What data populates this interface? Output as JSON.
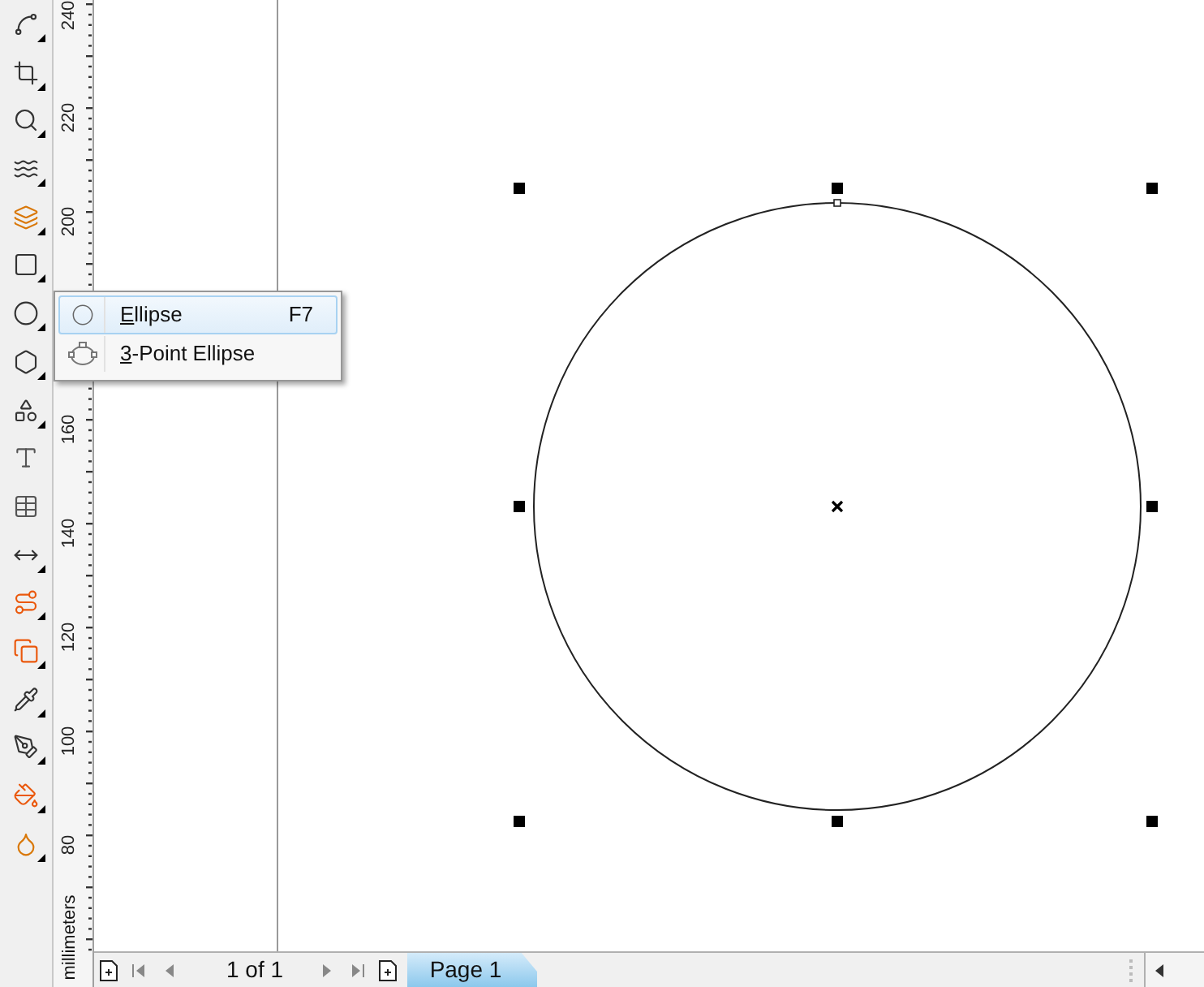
{
  "toolbox": {
    "tools": [
      {
        "flyout": true
      },
      {
        "flyout": true
      },
      {
        "flyout": true
      },
      {
        "flyout": true
      },
      {
        "flyout": true
      },
      {
        "flyout": true
      },
      {
        "flyout": true
      },
      {
        "flyout": true
      },
      {
        "flyout": true
      },
      {
        "flyout": false
      },
      {
        "flyout": false
      },
      {
        "flyout": true
      },
      {
        "flyout": true
      },
      {
        "flyout": true
      },
      {
        "flyout": true
      },
      {
        "flyout": true
      },
      {
        "flyout": true
      },
      {
        "flyout": true
      }
    ]
  },
  "ruler": {
    "labels": [
      "240",
      "220",
      "200",
      "160",
      "140",
      "120",
      "100",
      "80"
    ],
    "unit": "millimeters"
  },
  "flyout_menu": {
    "items": [
      {
        "mnemonic": "E",
        "rest": "llipse",
        "shortcut": "F7",
        "selected": true
      },
      {
        "mnemonic": "3",
        "rest": "-Point Ellipse",
        "selected": false
      }
    ]
  },
  "page_nav": {
    "counter": "1 of 1",
    "tabs": [
      {
        "label": "Page 1",
        "selected": true
      }
    ]
  }
}
